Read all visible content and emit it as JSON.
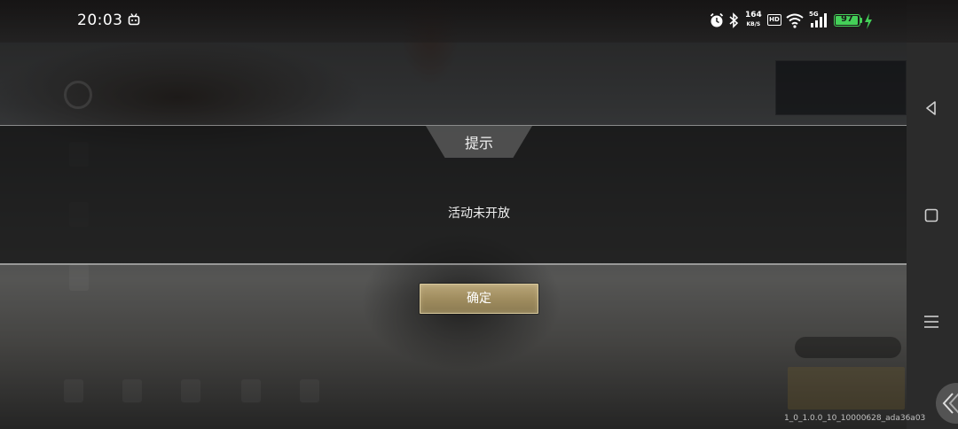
{
  "status_bar": {
    "time": "20:03",
    "net_speed_value": "164",
    "net_speed_unit": "KB/S",
    "hd_label": "HD",
    "signal_label": "5G",
    "battery_level": "97",
    "battery_percent": 97,
    "battery_color": "#44d058",
    "icons": [
      "app-notification-icon",
      "alarm-icon",
      "bluetooth-icon",
      "wifi-icon",
      "cellular-signal-icon",
      "charging-icon"
    ]
  },
  "dialog": {
    "title": "提示",
    "message": "活动未开放",
    "confirm_label": "确定"
  },
  "footer": {
    "build_version": "1_0_1.0.0_10_10000628_ada36a03"
  },
  "nav_bar": {
    "buttons": [
      "back-icon",
      "home-icon",
      "menu-icon"
    ]
  },
  "colors": {
    "button_gold": "#a08d5f",
    "button_border": "#d8c99c",
    "dialog_bg": "#121212"
  }
}
